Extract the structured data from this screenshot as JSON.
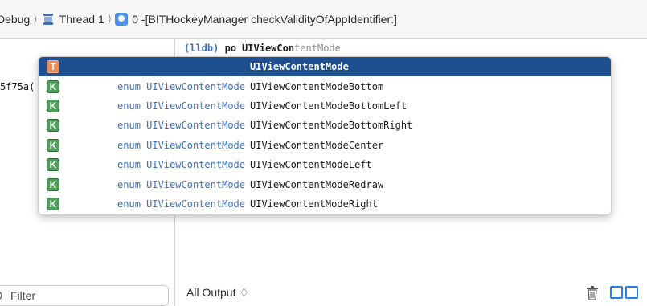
{
  "breadcrumb": {
    "segments": [
      {
        "label": "Debug"
      },
      {
        "label": "Thread 1"
      },
      {
        "label": "0 -[BITHockeyManager checkValidityOfAppIdentifier:]"
      }
    ]
  },
  "variables": {
    "truncated_value": "5f75a("
  },
  "filter": {
    "placeholder": "Filter"
  },
  "console": {
    "prompt": "(lldb)",
    "command": "po",
    "typed": "UIViewCon",
    "ghost_completion": "tentMode",
    "output_selector": "All Output ♢"
  },
  "completions": [
    {
      "badge": "T",
      "type": "",
      "name": "UIViewContentMode",
      "selected": true
    },
    {
      "badge": "K",
      "type": "enum UIViewContentMode",
      "name": "UIViewContentModeBottom",
      "selected": false
    },
    {
      "badge": "K",
      "type": "enum UIViewContentMode",
      "name": "UIViewContentModeBottomLeft",
      "selected": false
    },
    {
      "badge": "K",
      "type": "enum UIViewContentMode",
      "name": "UIViewContentModeBottomRight",
      "selected": false
    },
    {
      "badge": "K",
      "type": "enum UIViewContentMode",
      "name": "UIViewContentModeCenter",
      "selected": false
    },
    {
      "badge": "K",
      "type": "enum UIViewContentMode",
      "name": "UIViewContentModeLeft",
      "selected": false
    },
    {
      "badge": "K",
      "type": "enum UIViewContentMode",
      "name": "UIViewContentModeRedraw",
      "selected": false
    },
    {
      "badge": "K",
      "type": "enum UIViewContentMode",
      "name": "UIViewContentModeRight",
      "selected": false
    }
  ],
  "colors": {
    "selection": "#1d4f91",
    "type_text": "#3c71b9",
    "keyword_badge": "#4d9e57",
    "type_badge": "#e98b5a",
    "toggle_blue": "#2f7de1"
  },
  "icons": {
    "thread": "thread-spool-icon",
    "frame": "stack-frame-icon",
    "filter": "filter-icon",
    "trash": "trash-icon",
    "view_toggle": "split-view-icon"
  }
}
